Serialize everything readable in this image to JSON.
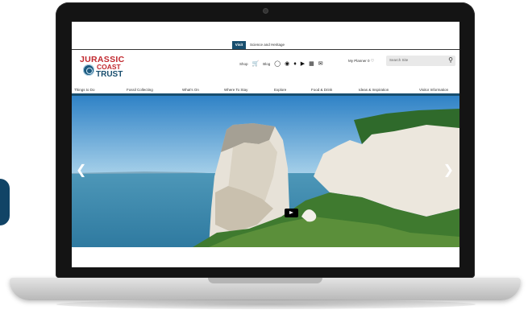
{
  "site": {
    "tabs": [
      {
        "label": "Visit",
        "active": true
      },
      {
        "label": "Science and Heritage",
        "active": false
      }
    ],
    "logo": {
      "line1": "JURASSIC",
      "line2": "COAST",
      "line3": "TRUST"
    },
    "utility": {
      "shop_label": "Shop",
      "blog_label": "Blog",
      "planner_label": "My Planner",
      "planner_count": "0",
      "search_placeholder": "Search Site"
    },
    "nav": [
      {
        "label": "Things to Do"
      },
      {
        "label": "Fossil Collecting"
      },
      {
        "label": "What's On"
      },
      {
        "label": "Where To Stay"
      },
      {
        "label": "Explore"
      },
      {
        "label": "Food & Drink"
      },
      {
        "label": "Ideas & Inspiration"
      },
      {
        "label": "Visitor Information"
      }
    ],
    "icons": {
      "cart": "cart-icon",
      "instagram": "instagram-icon",
      "facebook": "facebook-icon",
      "twitter": "twitter-icon",
      "youtube": "youtube-icon",
      "gallery": "gallery-icon",
      "email": "email-icon",
      "heart": "heart-icon",
      "search": "search-icon",
      "prev": "chevron-left-icon",
      "next": "chevron-right-icon",
      "play": "play-icon"
    },
    "colors": {
      "brand_red": "#c0272d",
      "brand_blue": "#184e6e"
    }
  }
}
